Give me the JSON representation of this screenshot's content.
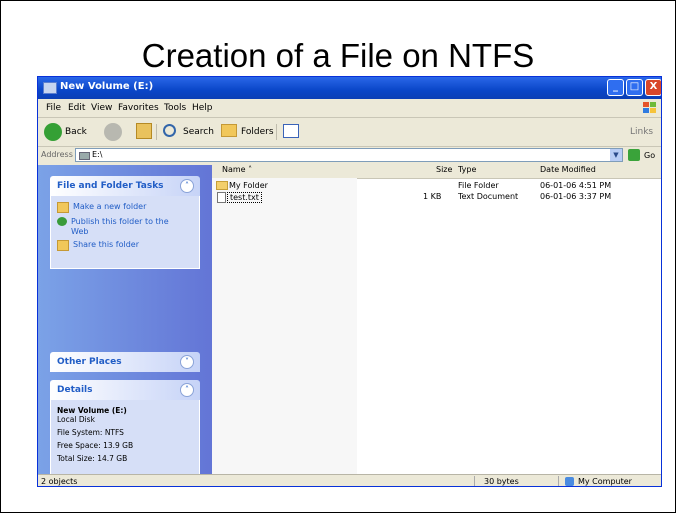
{
  "slide": {
    "title": "Creation of a File on NTFS"
  },
  "window": {
    "title": "New Volume (E:)",
    "controls": {
      "minimize": "_",
      "maximize": "□",
      "close": "X"
    }
  },
  "menu": {
    "file": "File",
    "edit": "Edit",
    "view": "View",
    "favorites": "Favorites",
    "tools": "Tools",
    "help": "Help"
  },
  "toolbar": {
    "back": "Back",
    "search": "Search",
    "folders": "Folders",
    "links": "Links"
  },
  "address": {
    "label": "Address",
    "value": "E:\\",
    "go": "Go"
  },
  "taskpane": {
    "file_tasks": {
      "title": "File and Folder Tasks",
      "items": [
        "Make a new folder",
        "Publish this folder to the",
        "Web",
        "Share this folder"
      ]
    },
    "other_places": {
      "title": "Other Places"
    },
    "details": {
      "title": "Details",
      "name": "New Volume (E:)",
      "kind": "Local Disk",
      "file_system": "File System: NTFS",
      "free_space": "Free Space: 13.9 GB",
      "total_size": "Total Size: 14.7 GB"
    }
  },
  "list": {
    "columns": {
      "name": "Name",
      "size": "Size",
      "type": "Type",
      "modified": "Date Modified"
    },
    "rows": [
      {
        "name": "My Folder",
        "size": "",
        "type": "File Folder",
        "modified": "06-01-06 4:51 PM"
      },
      {
        "name": "test.txt",
        "size": "1 KB",
        "type": "Text Document",
        "modified": "06-01-06 3:37 PM"
      }
    ]
  },
  "status": {
    "objects": "2 objects",
    "size": "30 bytes",
    "zone": "My Computer"
  },
  "icons": {
    "window": "drive-icon",
    "back": "back-arrow-icon",
    "forward": "forward-arrow-icon",
    "up": "up-folder-icon",
    "search": "search-icon",
    "folders": "folders-icon",
    "views": "views-icon",
    "new_folder": "new-folder-icon",
    "publish": "globe-icon",
    "share": "share-folder-icon",
    "folder": "folder-icon",
    "text_file": "text-file-icon",
    "computer": "computer-icon"
  }
}
